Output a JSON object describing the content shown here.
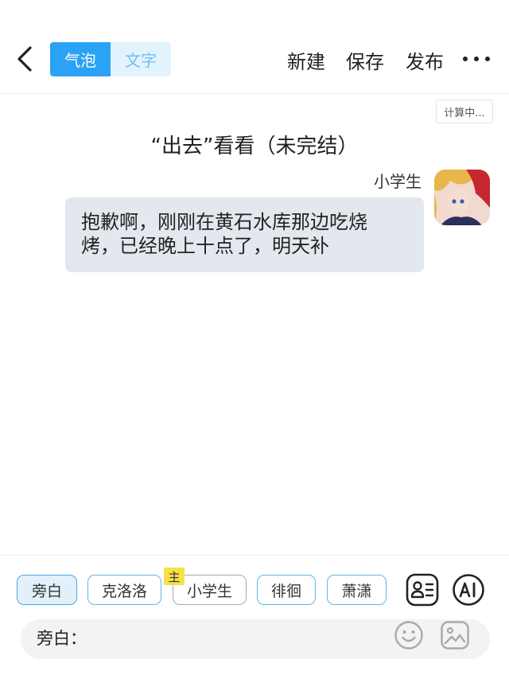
{
  "header": {
    "segments": [
      {
        "label": "气泡",
        "active": true
      },
      {
        "label": "文字",
        "active": false
      }
    ],
    "actions": {
      "new": "新建",
      "save": "保存",
      "publish": "发布"
    }
  },
  "status": "计算中...",
  "story_title": "“出去”看看（未完结）",
  "message": {
    "sender": "小学生",
    "lines": [
      "抱歉啊，刚刚在黄石水库那边吃烧",
      "烤，已经晚上十点了，明天补"
    ]
  },
  "characters": [
    {
      "label": "旁白",
      "selected": true
    },
    {
      "label": "克洛洛",
      "selected": false
    },
    {
      "label": "小学生",
      "selected": false,
      "badge": "主"
    },
    {
      "label": "徘徊",
      "selected": false
    },
    {
      "label": "萧潇",
      "selected": false
    }
  ],
  "input": {
    "speaker_label": "旁白：",
    "value": "",
    "placeholder": ""
  },
  "icons": {
    "back": "chevron-left-icon",
    "more": "more-dots-icon",
    "roles": "character-list-icon",
    "ai": "ai-icon",
    "emoji": "emoji-icon",
    "image": "image-icon"
  },
  "colors": {
    "accent": "#2aa2f5",
    "bubble": "#e3e7ee",
    "badge": "#f7e048"
  }
}
